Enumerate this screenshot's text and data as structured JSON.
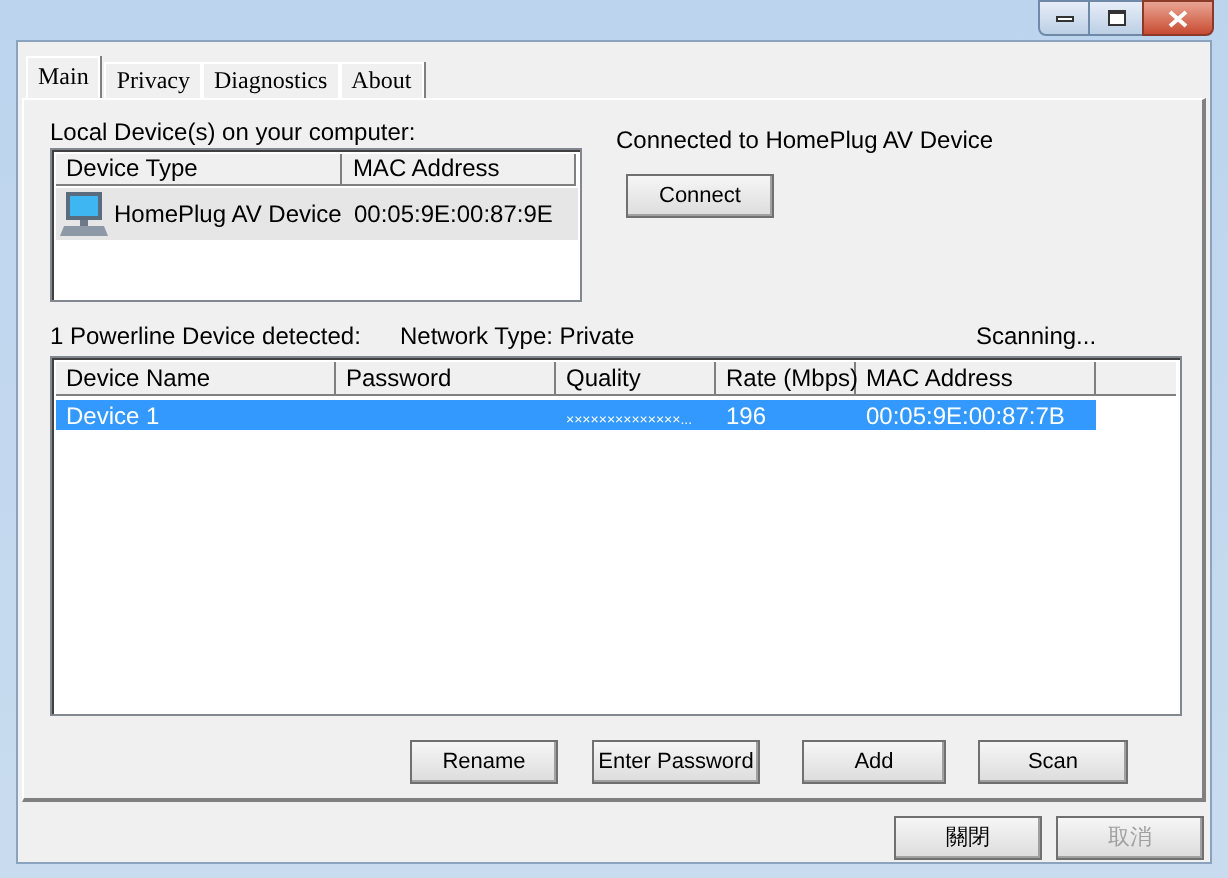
{
  "tabs": [
    {
      "label": "Main",
      "selected": true
    },
    {
      "label": "Privacy",
      "selected": false
    },
    {
      "label": "Diagnostics",
      "selected": false
    },
    {
      "label": "About",
      "selected": false
    }
  ],
  "local_devices": {
    "label": "Local Device(s) on your computer:",
    "columns": [
      "Device Type",
      "MAC Address"
    ],
    "rows": [
      {
        "device_type": "HomePlug AV Device",
        "mac_address": "00:05:9E:00:87:9E",
        "selected": true
      }
    ]
  },
  "connection": {
    "status": "Connected to HomePlug AV Device",
    "button": "Connect"
  },
  "status_line": {
    "detected": "1 Powerline Device detected:",
    "network_type": "Network Type: Private",
    "scan_state": "Scanning..."
  },
  "devices": {
    "columns": [
      "Device Name",
      "Password",
      "Quality",
      "Rate (Mbps)",
      "MAC Address"
    ],
    "rows": [
      {
        "device_name": "Device 1",
        "password": "",
        "quality": "××××××××××××××...",
        "rate": "196",
        "mac_address": "00:05:9E:00:87:7B",
        "selected": true
      }
    ]
  },
  "device_buttons": [
    "Rename",
    "Enter Password",
    "Add",
    "Scan"
  ],
  "dialog_buttons": [
    {
      "label": "關閉",
      "disabled": false
    },
    {
      "label": "取消",
      "disabled": true
    }
  ]
}
